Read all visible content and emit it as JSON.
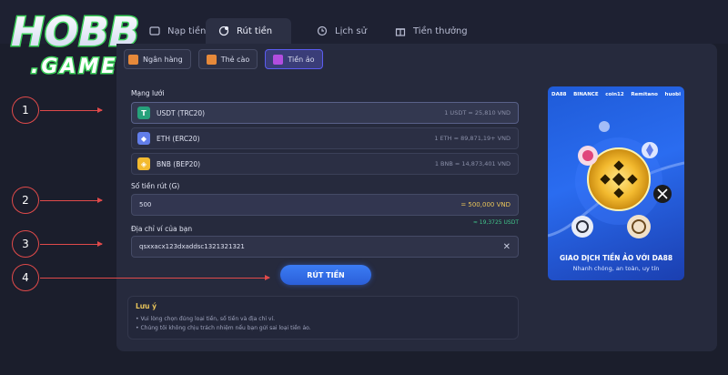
{
  "logo": {
    "line1": "HOBB",
    "line2": ".GAMES"
  },
  "tabs": [
    {
      "label": "Nạp tiền",
      "icon": "deposit-icon"
    },
    {
      "label": "Rút tiền",
      "icon": "withdraw-icon"
    },
    {
      "label": "Lịch sử",
      "icon": "history-icon"
    },
    {
      "label": "Tiền thưởng",
      "icon": "gift-icon"
    }
  ],
  "subtabs": [
    {
      "label": "Ngân hàng",
      "color": "#e6893a"
    },
    {
      "label": "Thẻ cào",
      "color": "#e6893a"
    },
    {
      "label": "Tiền ảo",
      "color": "#b24de0"
    }
  ],
  "network": {
    "label": "Mạng lưới",
    "options": [
      {
        "name": "USDT (TRC20)",
        "rate": "1 USDT = 25,810 VND",
        "icon": "usdt-icon",
        "color": "#26a17b",
        "glyph": "T"
      },
      {
        "name": "ETH (ERC20)",
        "rate": "1 ETH = 89,871,19+ VND",
        "icon": "eth-icon",
        "color": "#627eea",
        "glyph": "◆"
      },
      {
        "name": "BNB (BEP20)",
        "rate": "1 BNB = 14,873,401 VND",
        "icon": "bnb-icon",
        "color": "#f3ba2f",
        "glyph": "◈"
      }
    ]
  },
  "amount": {
    "label": "Số tiền rút (G)",
    "value": "500",
    "converted": "= 500,000 VND",
    "usdt_equiv": "≈ 19,3725 USDT"
  },
  "wallet": {
    "label": "Địa chỉ ví của bạn",
    "value": "qsxxacx123dxaddsc1321321321"
  },
  "submit_label": "RÚT TIỀN",
  "note": {
    "title": "Lưu ý",
    "items": [
      "Vui lòng chọn đúng loại tiền, số tiền và địa chỉ ví.",
      "Chúng tôi không chịu trách nhiệm nếu bạn gửi sai loại tiền ảo."
    ]
  },
  "banner": {
    "partners": [
      "DA88",
      "BINANCE",
      "coin12",
      "Remitano",
      "huobi"
    ],
    "title": "GIAO DỊCH TIỀN ẢO VỚI DA88",
    "subtitle": "Nhanh chóng, an toàn, uy tín"
  },
  "markers": [
    "1",
    "2",
    "3",
    "4"
  ]
}
